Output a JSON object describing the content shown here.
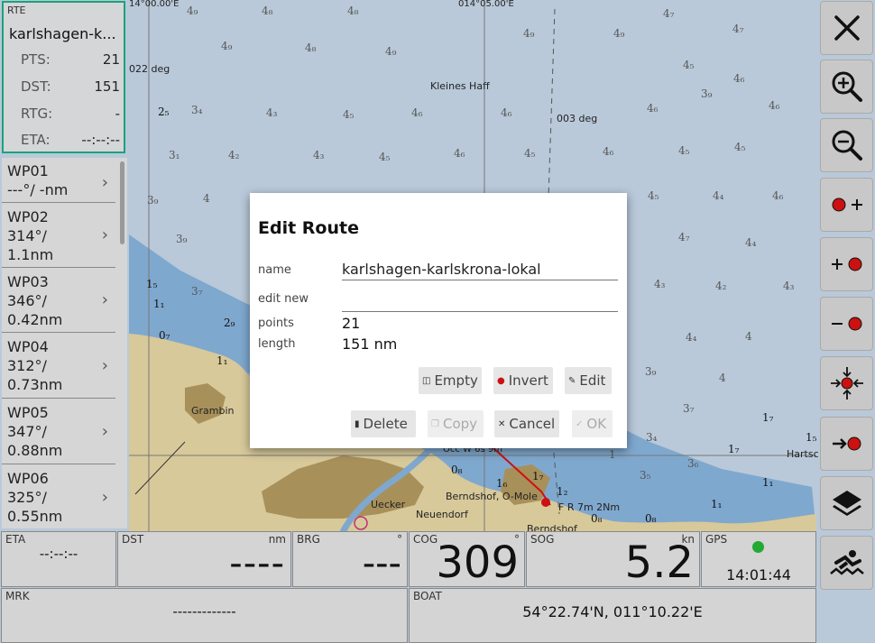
{
  "map": {
    "coord_top_left": "14°00.00'E",
    "coord_top_mid": "014°05.00'E",
    "bearing_label_1": "022 deg",
    "bearing_label_2": "003 deg",
    "place_kleines_haff": "Kleines Haff",
    "place_grambin": "Grambin",
    "place_ueckermunde": "Uecker",
    "place_neuendorf": "Neuendorf",
    "place_berndshof": "Berndshof, O-Mole",
    "place_berndshof2": "Berndshof",
    "light_label": "F R 7m 2Nm",
    "place_hartsch": "Hartsc",
    "occ_label": "Occ W 6s 9m"
  },
  "route_panel": {
    "header": "RTE",
    "name": "karlshagen-k...",
    "rows": [
      {
        "key": "PTS:",
        "value": "21"
      },
      {
        "key": "DST:",
        "value": "151"
      },
      {
        "key": "RTG:",
        "value": "-"
      },
      {
        "key": "ETA:",
        "value": "--:--:--"
      }
    ]
  },
  "waypoints": [
    {
      "name": "WP01",
      "line2": "---°/ -nm"
    },
    {
      "name": "WP02",
      "line2": "314°/",
      "line3": "1.1nm"
    },
    {
      "name": "WP03",
      "line2": "346°/",
      "line3": "0.42nm"
    },
    {
      "name": "WP04",
      "line2": "312°/",
      "line3": "0.73nm"
    },
    {
      "name": "WP05",
      "line2": "347°/",
      "line3": "0.88nm"
    },
    {
      "name": "WP06",
      "line2": "325°/",
      "line3": "0.55nm"
    }
  ],
  "toolbar": {
    "items": [
      "close-icon",
      "zoom-in-icon",
      "zoom-out-icon",
      "add-waypoint-after-icon",
      "add-waypoint-before-icon",
      "delete-waypoint-icon",
      "center-target-icon",
      "goto-waypoint-icon",
      "layers-icon",
      "anchor-watch-icon"
    ]
  },
  "dialog": {
    "title": "Edit Route",
    "name_label": "name",
    "name_value": "karlshagen-karlskrona-lokal",
    "edit_new_label": "edit new",
    "edit_new_value": "",
    "points_label": "points",
    "points_value": "21",
    "length_label": "length",
    "length_value": "151 nm",
    "buttons": {
      "empty": "Empty",
      "invert": "Invert",
      "edit": "Edit",
      "delete": "Delete",
      "copy": "Copy",
      "cancel": "Cancel",
      "ok": "OK"
    }
  },
  "bottom": {
    "eta": {
      "label": "ETA",
      "value": "--:--:--"
    },
    "dst": {
      "label": "DST",
      "unit": "nm",
      "value": "----"
    },
    "brg": {
      "label": "BRG",
      "unit": "°",
      "value": "---"
    },
    "cog": {
      "label": "COG",
      "unit": "°",
      "value": "309"
    },
    "sog": {
      "label": "SOG",
      "unit": "kn",
      "value": "5.2"
    },
    "gps": {
      "label": "GPS",
      "value": "14:01:44"
    },
    "mrk": {
      "label": "MRK",
      "value": "-------------"
    },
    "boat": {
      "label": "BOAT",
      "value": "54°22.74'N, 011°10.22'E"
    }
  },
  "colors": {
    "water": "#b9c9d9",
    "shallow": "#7aa6d0",
    "land": "#d4c596",
    "urban": "#a8905a",
    "accent_green": "#1aa37a",
    "gps_ok": "#22aa33",
    "waypoint_red": "#cc1111"
  }
}
